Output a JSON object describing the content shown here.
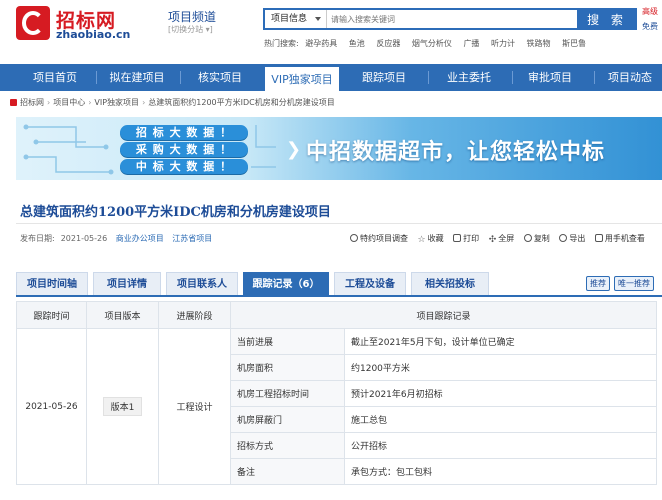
{
  "header": {
    "logo_cn": "招标网",
    "logo_en": "zhaobiao.cn",
    "channel": "项目频道",
    "channel_switch": "[切换分站 ▾]",
    "corner_line1": "高级",
    "corner_line2": "免费"
  },
  "search": {
    "category": "项目信息",
    "placeholder": "请输入搜索关键词",
    "button": "搜 索"
  },
  "hot": {
    "label": "热门搜索:",
    "items": [
      "避孕药具",
      "鱼池",
      "反应器",
      "烟气分析仪",
      "广播",
      "听力计",
      "铁路物",
      "斯巴鲁"
    ]
  },
  "nav": {
    "items": [
      "项目首页",
      "拟在建项目",
      "核实项目",
      "VIP独家项目",
      "跟踪项目",
      "业主委托",
      "审批项目",
      "项目动态"
    ],
    "active": 3
  },
  "breadcrumb": {
    "items": [
      "招标网",
      "项目中心",
      "VIP独家项目",
      "总建筑面积约1200平方米IDC机房和分机房建设项目"
    ]
  },
  "banner": {
    "pills": [
      "招 标 大 数 据 ！",
      "采 购 大 数 据 ！",
      "中 标 大 数 据 ！"
    ],
    "slogan": "中招数据超市，让您轻松中标"
  },
  "project": {
    "title": "总建筑面积约1200平方米IDC机房和分机房建设项目",
    "publish_label": "发布日期:",
    "publish_date": "2021-05-26",
    "category_link": "商业办公项目",
    "region_link": "江苏省项目"
  },
  "actions": [
    "特约项目调查",
    "收藏",
    "打印",
    "全屏",
    "复制",
    "导出",
    "用手机查看"
  ],
  "tabs": {
    "items": [
      "项目时间轴",
      "项目详情",
      "项目联系人",
      "跟踪记录（6）",
      "工程及设备",
      "相关招投标"
    ],
    "active": 3,
    "right": [
      "推荐",
      "唯一推荐"
    ]
  },
  "table": {
    "headers": [
      "跟踪时间",
      "项目版本",
      "进展阶段",
      "项目跟踪记录"
    ],
    "row": {
      "date": "2021-05-26",
      "version": "版本1",
      "stage": "工程设计"
    },
    "records": [
      {
        "key": "当前进展",
        "value": "截止至2021年5月下旬，设计单位已确定"
      },
      {
        "key": "机房面积",
        "value": "约1200平方米"
      },
      {
        "key": "机房工程招标时间",
        "value": "预计2021年6月初招标"
      },
      {
        "key": "机房屏蔽门",
        "value": "施工总包"
      },
      {
        "key": "招标方式",
        "value": "公开招标"
      },
      {
        "key": "备注",
        "value": "承包方式：包工包料"
      }
    ]
  },
  "colors": {
    "primary": "#2d6cb5",
    "brand_red": "#d61b22",
    "title_blue": "#1d4c97"
  }
}
